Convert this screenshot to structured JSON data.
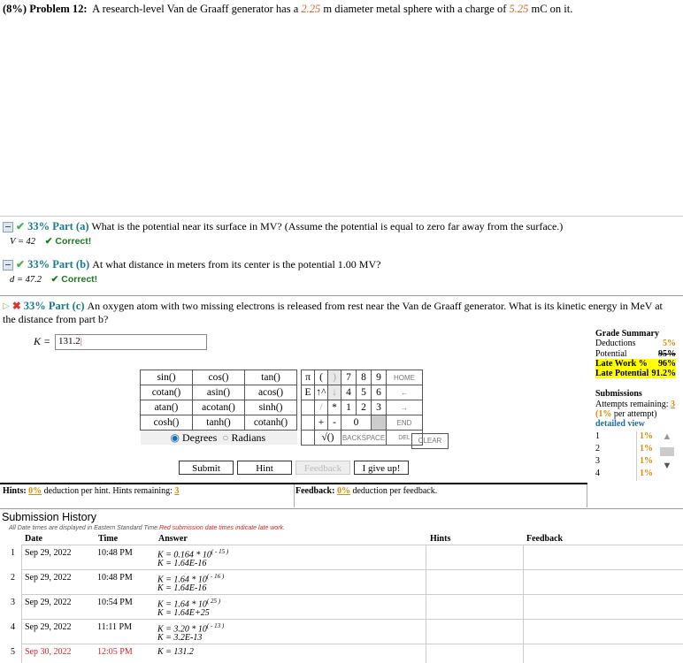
{
  "problem": {
    "label": "(8%) Problem 12:",
    "text_a": "A research-level Van de Graaff generator has a",
    "diameter": "2.25",
    "text_b": "m diameter metal sphere with a charge of",
    "charge": "5.25",
    "text_c": "mC on it."
  },
  "part_a": {
    "pct": "33% Part (a)",
    "question": "What is the potential near its surface in MV? (Assume the potential is equal to zero far away from the surface.)",
    "answer": "V = 42",
    "status": "✔ Correct!"
  },
  "part_b": {
    "pct": "33% Part (b)",
    "question": "At what distance in meters from its center is the potential 1.00 MV?",
    "answer": "d = 47.2",
    "status": "✔ Correct!"
  },
  "part_c": {
    "pct": "33% Part (c)",
    "question_1": "An oxygen atom with two missing electrons is released from rest near the Van de Graaff generator. What is its kinetic energy in MeV at",
    "question_2": "the distance from part b?",
    "input_label": "K =",
    "input_value": "131.2"
  },
  "keypad": {
    "functions": [
      [
        "sin()",
        "cos()",
        "tan()"
      ],
      [
        "cotan()",
        "asin()",
        "acos()"
      ],
      [
        "atan()",
        "acotan()",
        "sinh()"
      ],
      [
        "cosh()",
        "tanh()",
        "cotanh()"
      ]
    ],
    "sym_rows": [
      [
        "π",
        "(",
        ")"
      ],
      [
        "E",
        "↑^",
        "↓"
      ],
      [
        "",
        "/",
        "*"
      ],
      [
        "",
        "+",
        "-"
      ]
    ],
    "digit_rows": [
      [
        "7",
        "8",
        "9"
      ],
      [
        "4",
        "5",
        "6"
      ],
      [
        "1",
        "2",
        "3"
      ]
    ],
    "zero": "0",
    "side_keys": [
      "HOME",
      "←",
      "→",
      "END"
    ],
    "sqrt": "√()",
    "backspace": "BACKSPACE",
    "del": "DEL",
    "clear": "CLEAR",
    "degrees": "Degrees",
    "radians": "Radians"
  },
  "buttons": {
    "submit": "Submit",
    "hint": "Hint",
    "feedback": "Feedback",
    "give_up": "I give up!"
  },
  "grade": {
    "title": "Grade Summary",
    "deductions_label": "Deductions",
    "deductions_value": "5%",
    "potential_label": "Potential",
    "potential_value": "95%",
    "late_work_label": "Late Work %",
    "late_work_value": "96%",
    "late_potential_label": "Late Potential",
    "late_potential_value": "91.2%",
    "submissions_title": "Submissions",
    "attempts_text": "Attempts remaining:",
    "attempts_value": "3",
    "per_attempt_pct": "(1%",
    "per_attempt_text": "per attempt)",
    "detailed_view": "detailed view",
    "rows": [
      [
        "1",
        "1%"
      ],
      [
        "2",
        "1%"
      ],
      [
        "3",
        "1%"
      ],
      [
        "4",
        "1%"
      ]
    ]
  },
  "hints_bar": {
    "hints_label": "Hints:",
    "hints_pct": "0%",
    "hints_text": "deduction per hint. Hints remaining:",
    "hints_remaining": "3",
    "feedback_label": "Feedback:",
    "feedback_pct": "0%",
    "feedback_text": "deduction per feedback."
  },
  "history": {
    "title": "Submission History",
    "note": "All Date times are displayed in Eastern Standard Time.",
    "note_red": "Red submission date times indicate late work.",
    "headers": [
      "Date",
      "Time",
      "Answer",
      "Hints",
      "Feedback"
    ],
    "rows": [
      {
        "n": "1",
        "date": "Sep 29, 2022",
        "time": "10:48 PM",
        "ans1": "K = 0.164 * 10",
        "exp": "( - 15 )",
        "ans2": "K = 1.64E-16",
        "late": false
      },
      {
        "n": "2",
        "date": "Sep 29, 2022",
        "time": "10:48 PM",
        "ans1": "K = 1.64 * 10",
        "exp": "( - 16 )",
        "ans2": "K = 1.64E-16",
        "late": false
      },
      {
        "n": "3",
        "date": "Sep 29, 2022",
        "time": "10:54 PM",
        "ans1": "K = 1.64 * 10",
        "exp": "( 25 )",
        "ans2": "K = 1.64E+25",
        "late": false
      },
      {
        "n": "4",
        "date": "Sep 29, 2022",
        "time": "11:11 PM",
        "ans1": "K = 3.20 * 10",
        "exp": "( - 13 )",
        "ans2": "K = 3.2E-13",
        "late": false
      },
      {
        "n": "5",
        "date": "Sep 30, 2022",
        "time": "12:05 PM",
        "ans1": "K = 131.2",
        "exp": "",
        "ans2": "",
        "late": true
      }
    ]
  }
}
